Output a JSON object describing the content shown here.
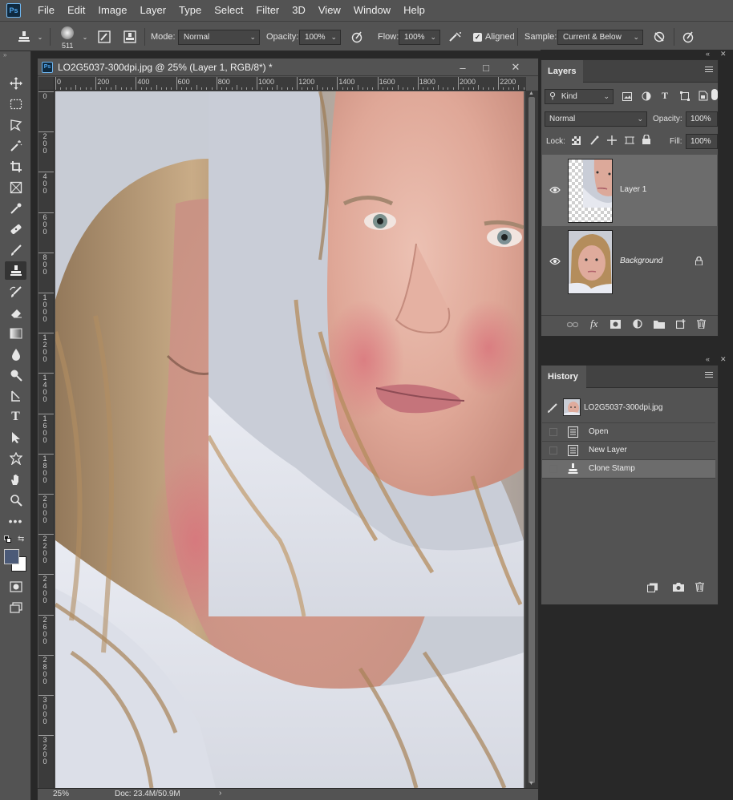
{
  "app": {
    "logo": "Ps"
  },
  "menu": [
    "File",
    "Edit",
    "Image",
    "Layer",
    "Type",
    "Select",
    "Filter",
    "3D",
    "View",
    "Window",
    "Help"
  ],
  "options_bar": {
    "brush_size": "511",
    "mode_label": "Mode:",
    "mode_value": "Normal",
    "opacity_label": "Opacity:",
    "opacity_value": "100%",
    "flow_label": "Flow:",
    "flow_value": "100%",
    "aligned_label": "Aligned",
    "aligned_checked": true,
    "sample_label": "Sample:",
    "sample_value": "Current & Below"
  },
  "tools": [
    "move-icon",
    "marquee-icon",
    "lasso-icon",
    "quick-select-icon",
    "crop-icon",
    "frame-icon",
    "eyedropper-icon",
    "healing-brush-icon",
    "brush-icon",
    "clone-stamp-icon",
    "history-brush-icon",
    "eraser-icon",
    "gradient-icon",
    "blur-icon",
    "dodge-icon",
    "pen-icon",
    "type-icon",
    "path-select-icon",
    "shape-icon",
    "hand-icon",
    "zoom-icon",
    "more-tools-icon"
  ],
  "active_tool": "clone-stamp-icon",
  "colors": {
    "foreground": "#4b5a78",
    "background": "#ffffff",
    "panel_bg": "#535353",
    "accent": "#4fa6ee"
  },
  "document": {
    "title": "LO2G5037-300dpi.jpg @ 25% (Layer 1, RGB/8*) *",
    "ruler_labels": [
      "0",
      "200",
      "400",
      "600",
      "800",
      "1000",
      "1200",
      "1400",
      "1600",
      "1800",
      "2000",
      "2200"
    ],
    "ruler_v_labels": [
      "0",
      "200",
      "400",
      "600",
      "800",
      "1000",
      "1200",
      "1400",
      "1600",
      "1800",
      "2000",
      "2200",
      "2400",
      "2600",
      "2800",
      "3000",
      "3200"
    ],
    "zoom": "25%",
    "doc_size": "Doc: 23.4M/50.9M"
  },
  "layers_panel": {
    "tab": "Layers",
    "kind_label": "Kind",
    "blend_mode": "Normal",
    "opacity_label": "Opacity:",
    "opacity_value": "100%",
    "lock_label": "Lock:",
    "fill_label": "Fill:",
    "fill_value": "100%",
    "layers": [
      {
        "name": "Layer 1",
        "visible": true,
        "selected": true,
        "locked": false
      },
      {
        "name": "Background",
        "visible": true,
        "selected": false,
        "locked": true
      }
    ]
  },
  "history_panel": {
    "tab": "History",
    "snapshot": "LO2G5037-300dpi.jpg",
    "states": [
      "Open",
      "New Layer",
      "Clone Stamp"
    ],
    "current_state": "Clone Stamp"
  }
}
